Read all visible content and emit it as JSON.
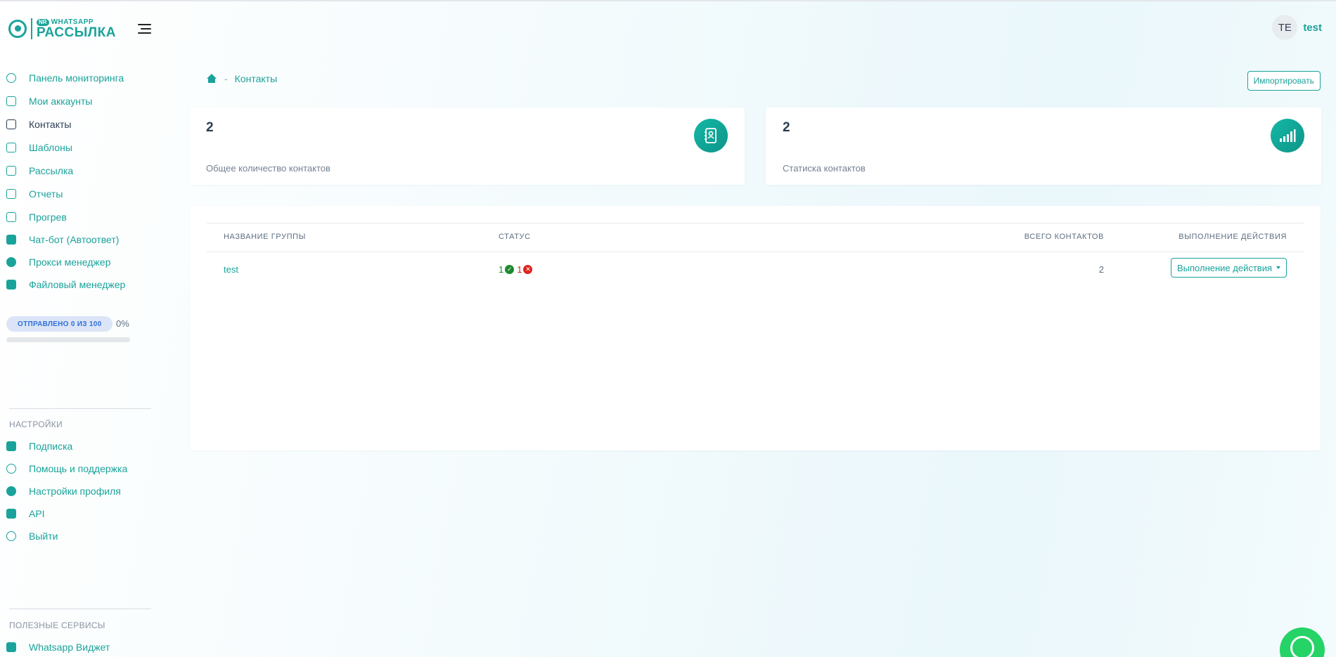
{
  "brand": {
    "badge": "NR",
    "sub": "WHATSAPP",
    "main": "РАССЫЛКА"
  },
  "user": {
    "initials": "TE",
    "name": "test"
  },
  "nav": {
    "items": [
      {
        "label": "Панель мониторинга",
        "icon": "dashboard-icon"
      },
      {
        "label": "Мои аккаунты",
        "icon": "accounts-icon"
      },
      {
        "label": "Контакты",
        "icon": "contacts-icon"
      },
      {
        "label": "Шаблоны",
        "icon": "templates-icon"
      },
      {
        "label": "Рассылка",
        "icon": "send-icon"
      },
      {
        "label": "Отчеты",
        "icon": "reports-icon"
      },
      {
        "label": "Прогрев",
        "icon": "warmup-icon"
      },
      {
        "label": "Чат-бот (Автоответ)",
        "icon": "bot-icon"
      },
      {
        "label": "Прокси менеджер",
        "icon": "proxy-icon"
      },
      {
        "label": "Файловый менеджер",
        "icon": "folder-icon"
      }
    ],
    "active": "Контакты"
  },
  "sent": {
    "label": "ОТПРАВЛЕНО 0 ИЗ 100",
    "percent_text": "0%",
    "progress": 0
  },
  "settings": {
    "title": "НАСТРОЙКИ",
    "items": [
      {
        "label": "Подписка",
        "icon": "rocket-icon"
      },
      {
        "label": "Помощь и поддержка",
        "icon": "headset-icon"
      },
      {
        "label": "Настройки профиля",
        "icon": "gear-icon"
      },
      {
        "label": "API",
        "icon": "key-icon"
      },
      {
        "label": "Выйти",
        "icon": "power-icon"
      }
    ]
  },
  "services": {
    "title": "ПОЛЕЗНЫЕ СЕРВИСЫ",
    "items": [
      {
        "label": "Whatsapp Виджет",
        "icon": "rocket-icon"
      }
    ]
  },
  "breadcrumb": {
    "current": "Контакты",
    "separator": "-"
  },
  "import_button": "Импортировать",
  "stats": [
    {
      "value": "2",
      "label": "Общее количество контактов",
      "icon": "address-book-icon"
    },
    {
      "value": "2",
      "label": "Статиска контактов",
      "icon": "signal-bars-icon"
    }
  ],
  "table": {
    "headers": [
      "НАЗВАНИЕ ГРУППЫ",
      "СТАТУС",
      "ВСЕГО КОНТАКТОВ",
      "ВЫПОЛНЕНИЕ ДЕЙСТВИЯ"
    ],
    "rows": [
      {
        "name": "test",
        "ok_count": "1",
        "fail_count": "1",
        "total": "2",
        "action": "Выполнение действия"
      }
    ]
  },
  "colors": {
    "accent": "#1aa39a",
    "success": "#1a8a2e",
    "danger": "#d9251c"
  }
}
